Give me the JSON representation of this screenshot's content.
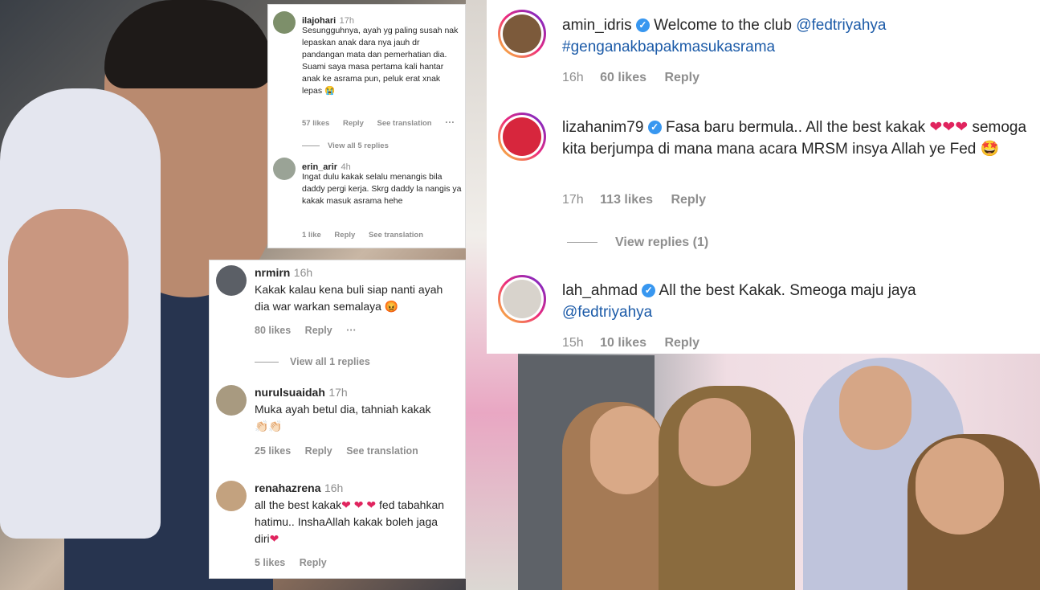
{
  "top_card": {
    "comments": [
      {
        "username": "ilajohari",
        "time": "17h",
        "text": "Sesungguhnya, ayah yg paling susah nak lepaskan anak dara nya jauh dr pandangan mata dan pemerhatian dia. Suami saya masa pertama kali hantar anak ke asrama pun, peluk erat xnak lepas",
        "emoji": "😭",
        "likes": "57 likes",
        "reply": "Reply",
        "translate": "See translation",
        "more": "···",
        "view_replies": "View all 5 replies"
      },
      {
        "username": "erin_arir",
        "time": "4h",
        "text": "Ingat dulu kakak selalu menangis bila daddy pergi kerja. Skrg daddy la nangis ya kakak masuk asrama hehe",
        "likes": "1 like",
        "reply": "Reply",
        "translate": "See translation"
      }
    ]
  },
  "mid_card": {
    "comments": [
      {
        "username": "nrmirn",
        "time": "16h",
        "text": "Kakak kalau kena buli siap nanti ayah dia war warkan semalaya",
        "emoji": "😡",
        "likes": "80 likes",
        "reply": "Reply",
        "more": "···",
        "view_replies": "View all 1 replies"
      },
      {
        "username": "nurulsuaidah",
        "time": "17h",
        "text": "Muka ayah betul dia, tahniah kakak",
        "emoji": "👏🏻👏🏻",
        "likes": "25 likes",
        "reply": "Reply",
        "translate": "See translation"
      },
      {
        "username": "renahazrena",
        "time": "16h",
        "text_a": "all the best kakak",
        "text_b": "fed",
        "text_c": "tabahkan hatimu.. InshaAllah kakak boleh jaga diri",
        "likes": "5 likes",
        "reply": "Reply"
      }
    ]
  },
  "right_card": {
    "comments": [
      {
        "username": "amin_idris",
        "text": "Welcome to the club",
        "mention": "@fedtriyahya",
        "hashtag": "#genganakbapakmasukasrama",
        "time": "16h",
        "likes": "60 likes",
        "reply": "Reply"
      },
      {
        "username": "lizahanim79",
        "text_a": "Fasa baru bermula.. All the best kakak",
        "text_b": "semoga kita berjumpa di mana mana acara MRSM insya Allah ye Fed",
        "emoji": "🤩",
        "time": "17h",
        "likes": "113 likes",
        "reply": "Reply",
        "view_replies": "View replies (1)"
      },
      {
        "username": "lah_ahmad",
        "text": "All the best Kakak. Smeoga maju jaya",
        "mention": "@fedtriyahya",
        "time": "15h",
        "likes": "10 likes",
        "reply": "Reply"
      }
    ]
  },
  "icons": {
    "verified": "verified-badge-icon",
    "heart": "heart-icon"
  },
  "colors": {
    "heart": "#e0245e",
    "verified": "#3897f0",
    "link": "#1c5ba8",
    "meta": "#8e8e8e"
  }
}
